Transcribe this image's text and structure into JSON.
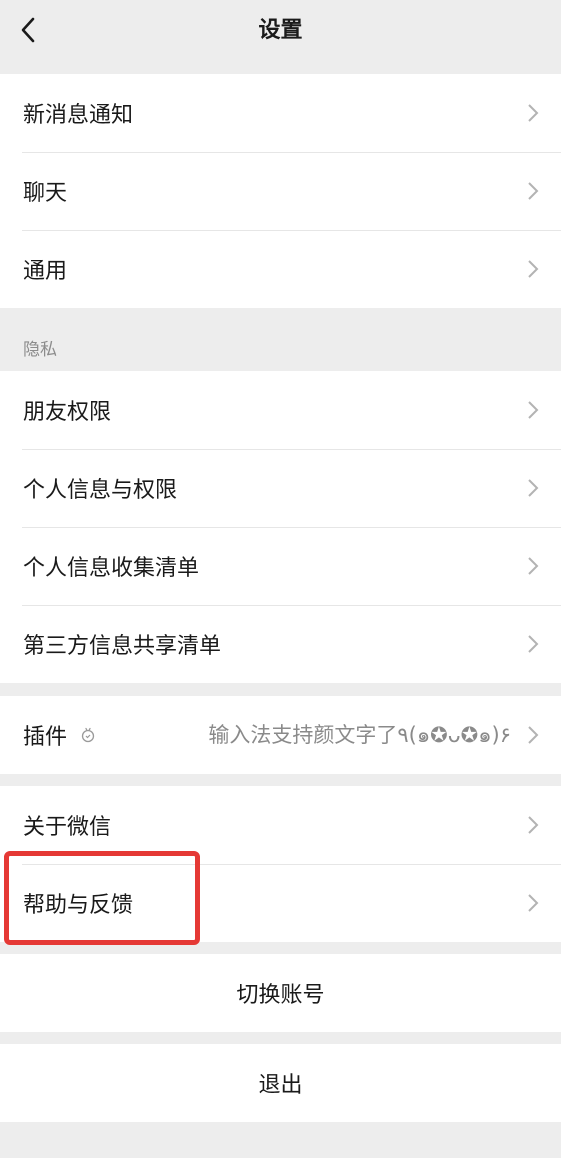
{
  "header": {
    "title": "设置"
  },
  "group1": {
    "items": [
      {
        "label": "新消息通知"
      },
      {
        "label": "聊天"
      },
      {
        "label": "通用"
      }
    ]
  },
  "privacy": {
    "section_title": "隐私",
    "items": [
      {
        "label": "朋友权限"
      },
      {
        "label": "个人信息与权限"
      },
      {
        "label": "个人信息收集清单"
      },
      {
        "label": "第三方信息共享清单"
      }
    ]
  },
  "plugins": {
    "label": "插件",
    "value": "输入法支持颜文字了٩(๑✪ᴗ✪๑)۶"
  },
  "group4": {
    "items": [
      {
        "label": "关于微信"
      },
      {
        "label": "帮助与反馈"
      }
    ]
  },
  "actions": {
    "switch_account": "切换账号",
    "logout": "退出"
  },
  "colors": {
    "background": "#ededed",
    "card": "#ffffff",
    "highlight": "#e53935",
    "secondary_text": "#8c8c8c"
  }
}
